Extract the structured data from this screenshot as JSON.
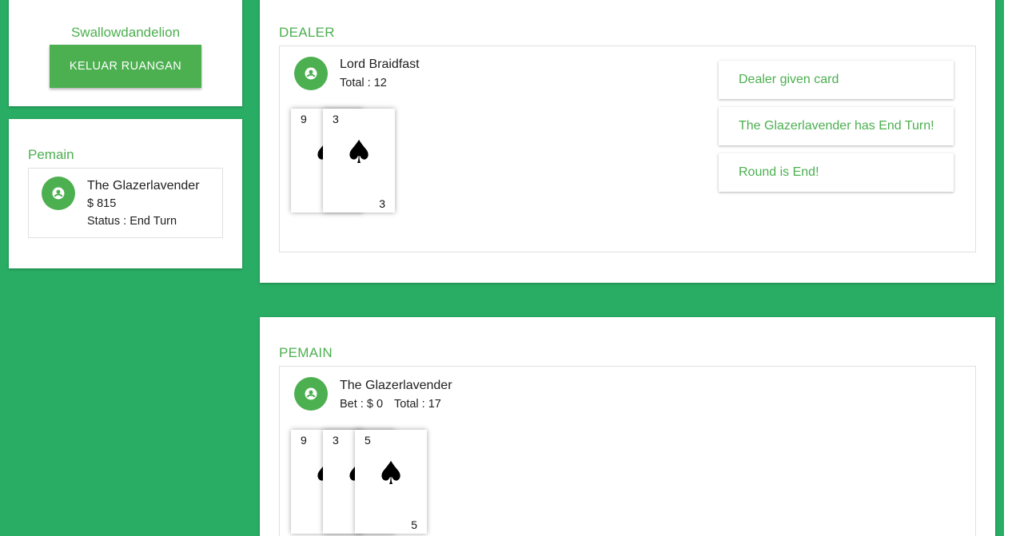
{
  "room": {
    "name": "Swallowdandelion",
    "leave_button": "KELUAR RUANGAN"
  },
  "players_panel": {
    "title": "Pemain",
    "player": {
      "name": "The Glazerlavender",
      "money": "$ 815",
      "status": "Status : End Turn",
      "avatar_icon": "account-circle-icon"
    }
  },
  "dealer": {
    "section_title": "DEALER",
    "name": "Lord Braidfast",
    "total": "Total : 12",
    "avatar_icon": "account-circle-icon",
    "cards": [
      {
        "rank": "9",
        "suit": "♠"
      },
      {
        "rank": "3",
        "suit": "♠"
      }
    ],
    "log": [
      "Dealer given card",
      "The Glazerlavender has End Turn!",
      "Round is End!"
    ]
  },
  "player": {
    "section_title": "PEMAIN",
    "name": "The Glazerlavender",
    "bet": "Bet : $ 0",
    "total": "Total : 17",
    "avatar_icon": "account-circle-icon",
    "cards": [
      {
        "rank": "9",
        "suit": "♠"
      },
      {
        "rank": "3",
        "suit": "♠"
      },
      {
        "rank": "5",
        "suit": "♠"
      }
    ]
  },
  "colors": {
    "background": "#29ac63",
    "accent": "#4caf50"
  }
}
